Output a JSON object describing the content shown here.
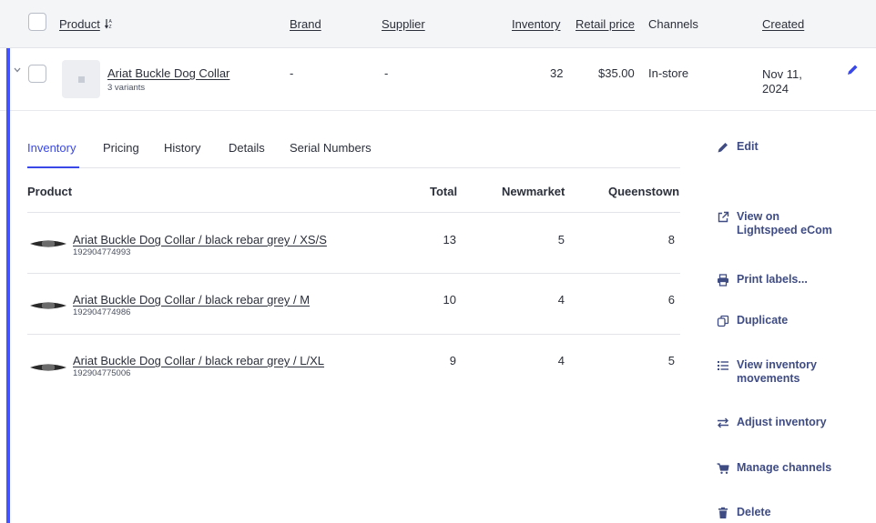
{
  "header": {
    "product": "Product",
    "sort_glyph": "↓A/Z",
    "brand": "Brand",
    "supplier": "Supplier",
    "inventory": "Inventory",
    "retail_price": "Retail price",
    "channels": "Channels",
    "created": "Created"
  },
  "product": {
    "name": "Ariat Buckle Dog Collar",
    "variants": "3 variants",
    "brand": "-",
    "supplier": "-",
    "inventory": "32",
    "retail_price": "$35.00",
    "channels": "In-store",
    "created_line1": "Nov 11,",
    "created_line2": "2024"
  },
  "tabs": [
    {
      "label": "Inventory"
    },
    {
      "label": "Pricing"
    },
    {
      "label": "History"
    },
    {
      "label": "Details"
    },
    {
      "label": "Serial Numbers"
    }
  ],
  "table": {
    "col_product": "Product",
    "col_total": "Total",
    "col_newmarket": "Newmarket",
    "col_queenstown": "Queenstown",
    "rows": [
      {
        "name": "Ariat Buckle Dog Collar / black rebar grey / XS/S",
        "sku": "192904774993",
        "total": "13",
        "newmarket": "5",
        "queenstown": "8"
      },
      {
        "name": "Ariat Buckle Dog Collar / black rebar grey / M",
        "sku": "192904774986",
        "total": "10",
        "newmarket": "4",
        "queenstown": "6"
      },
      {
        "name": "Ariat Buckle Dog Collar / black rebar grey / L/XL",
        "sku": "192904775006",
        "total": "9",
        "newmarket": "4",
        "queenstown": "5"
      }
    ]
  },
  "actions": {
    "edit": "Edit",
    "view_on_1": "View on",
    "view_on_2": "Lightspeed eCom",
    "print_labels": "Print labels...",
    "duplicate": "Duplicate",
    "view_movements_1": "View inventory",
    "view_movements_2": "movements",
    "adjust_inventory": "Adjust inventory",
    "manage_channels": "Manage channels",
    "delete": "Delete"
  },
  "colors": {
    "accent": "#4353ff",
    "action_text": "#3f4c83",
    "header_bg": "#f4f5f7"
  },
  "icons": [
    "pencil-icon",
    "external-link-icon",
    "printer-icon",
    "duplicate-icon",
    "list-icon",
    "swap-arrows-icon",
    "cart-icon",
    "trash-icon",
    "chevron-down-icon",
    "sort-az-icon"
  ]
}
